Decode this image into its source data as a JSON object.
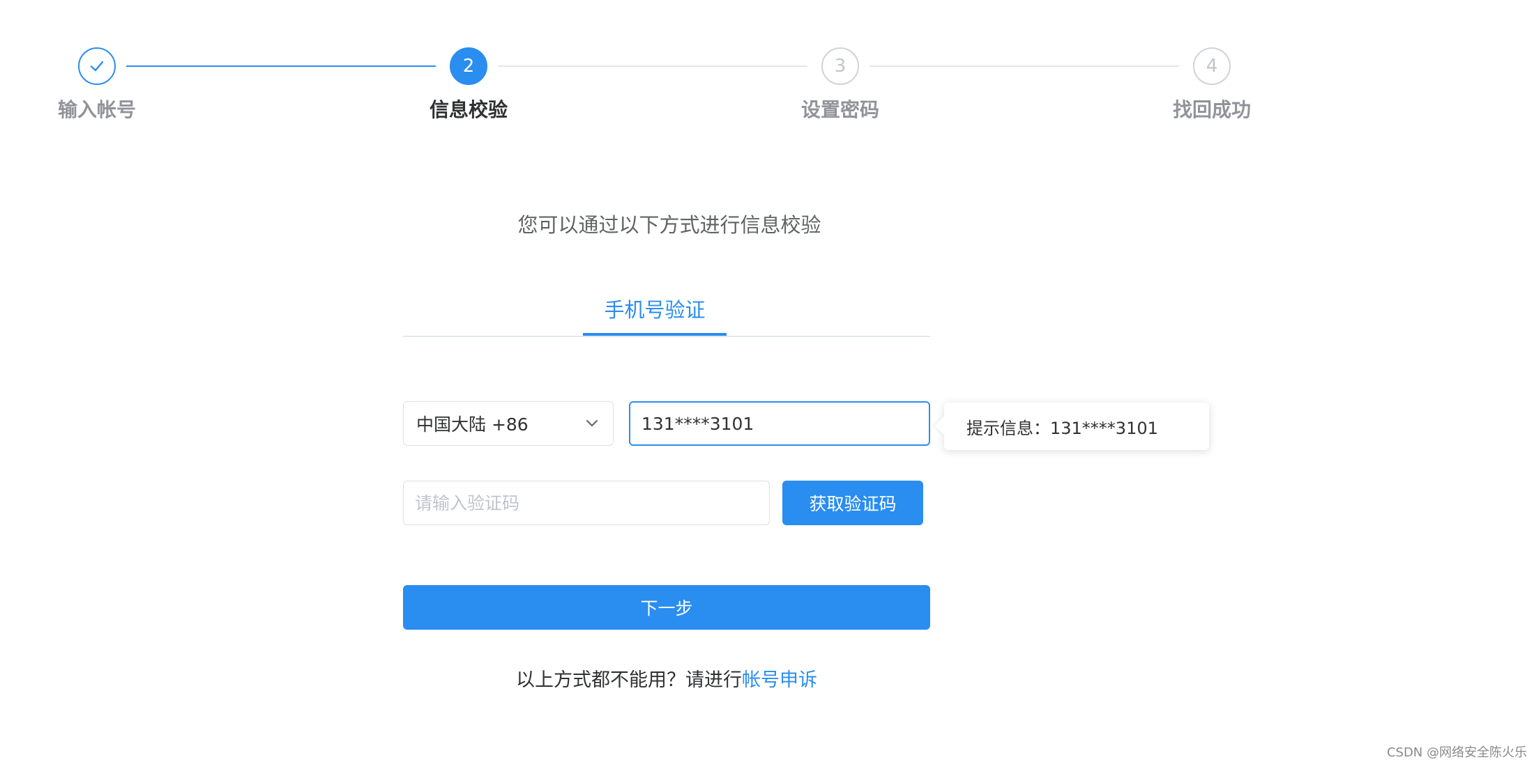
{
  "steps": [
    {
      "number": "1",
      "label": "输入帐号",
      "state": "done",
      "icon": "check-icon"
    },
    {
      "number": "2",
      "label": "信息校验",
      "state": "active"
    },
    {
      "number": "3",
      "label": "设置密码",
      "state": "pending"
    },
    {
      "number": "4",
      "label": "找回成功",
      "state": "pending"
    }
  ],
  "subtitle": "您可以通过以下方式进行信息校验",
  "tabs": [
    {
      "label": "手机号验证",
      "active": true
    }
  ],
  "form": {
    "region_value": "中国大陆 +86",
    "phone_value": "131****3101",
    "tooltip_text": "提示信息：131****3101",
    "code_placeholder": "请输入验证码",
    "get_code_label": "获取验证码",
    "next_label": "下一步"
  },
  "footer": {
    "prefix": "以上方式都不能用？请进行",
    "link": "帐号申诉"
  },
  "watermark": "CSDN @网络安全陈火乐",
  "colors": {
    "accent": "#2a8df0",
    "inactive": "#c0c4cc"
  }
}
